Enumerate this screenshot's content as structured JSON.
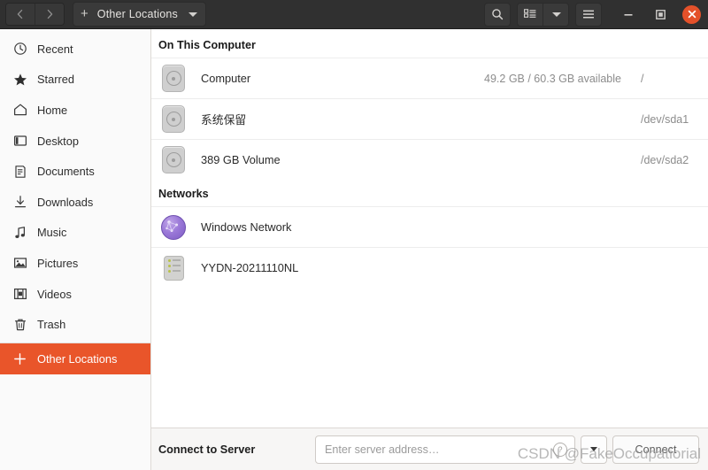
{
  "window": {
    "title": "Other Locations",
    "nav": {
      "back": "‹",
      "forward": "›"
    },
    "new_tab_label": "+",
    "buttons": {
      "search": "search-icon",
      "list_view": "list-view-icon",
      "view_dropdown": "chevron-down-icon",
      "menu": "hamburger-menu-icon",
      "minimize": "—",
      "maximize": "▣",
      "close": "✕"
    }
  },
  "sidebar": {
    "items": [
      {
        "label": "Recent",
        "icon": "clock-icon",
        "selected": false
      },
      {
        "label": "Starred",
        "icon": "star-icon",
        "selected": false
      },
      {
        "label": "Home",
        "icon": "home-icon",
        "selected": false
      },
      {
        "label": "Desktop",
        "icon": "desktop-icon",
        "selected": false
      },
      {
        "label": "Documents",
        "icon": "document-icon",
        "selected": false
      },
      {
        "label": "Downloads",
        "icon": "download-icon",
        "selected": false
      },
      {
        "label": "Music",
        "icon": "music-icon",
        "selected": false
      },
      {
        "label": "Pictures",
        "icon": "picture-icon",
        "selected": false
      },
      {
        "label": "Videos",
        "icon": "video-icon",
        "selected": false
      },
      {
        "label": "Trash",
        "icon": "trash-icon",
        "selected": false
      },
      {
        "label": "Other Locations",
        "icon": "plus-icon",
        "selected": true
      }
    ]
  },
  "main": {
    "groups": [
      {
        "title": "On This Computer",
        "rows": [
          {
            "name": "Computer",
            "free": "49.2 GB / 60.3 GB available",
            "mount": "/",
            "icon": "drive-icon"
          },
          {
            "name": "系统保留",
            "free": "",
            "mount": "/dev/sda1",
            "icon": "drive-icon"
          },
          {
            "name": "389 GB Volume",
            "free": "",
            "mount": "/dev/sda2",
            "icon": "drive-icon"
          }
        ]
      },
      {
        "title": "Networks",
        "rows": [
          {
            "name": "Windows Network",
            "free": "",
            "mount": "",
            "icon": "network-globe-icon"
          },
          {
            "name": "YYDN-20211110NL",
            "free": "",
            "mount": "",
            "icon": "server-icon"
          }
        ]
      }
    ]
  },
  "bottom": {
    "connect_label": "Connect to Server",
    "address_placeholder": "Enter server address…",
    "address_value": "",
    "help_glyph": "?",
    "connect_button": "Connect"
  },
  "watermark": {
    "text": "CSDN @FakeOccupatiorial"
  },
  "colors": {
    "accent": "#e9552a",
    "headerbar": "#303030",
    "sidebar_bg": "#fafafa",
    "close_button": "#e4512a"
  }
}
